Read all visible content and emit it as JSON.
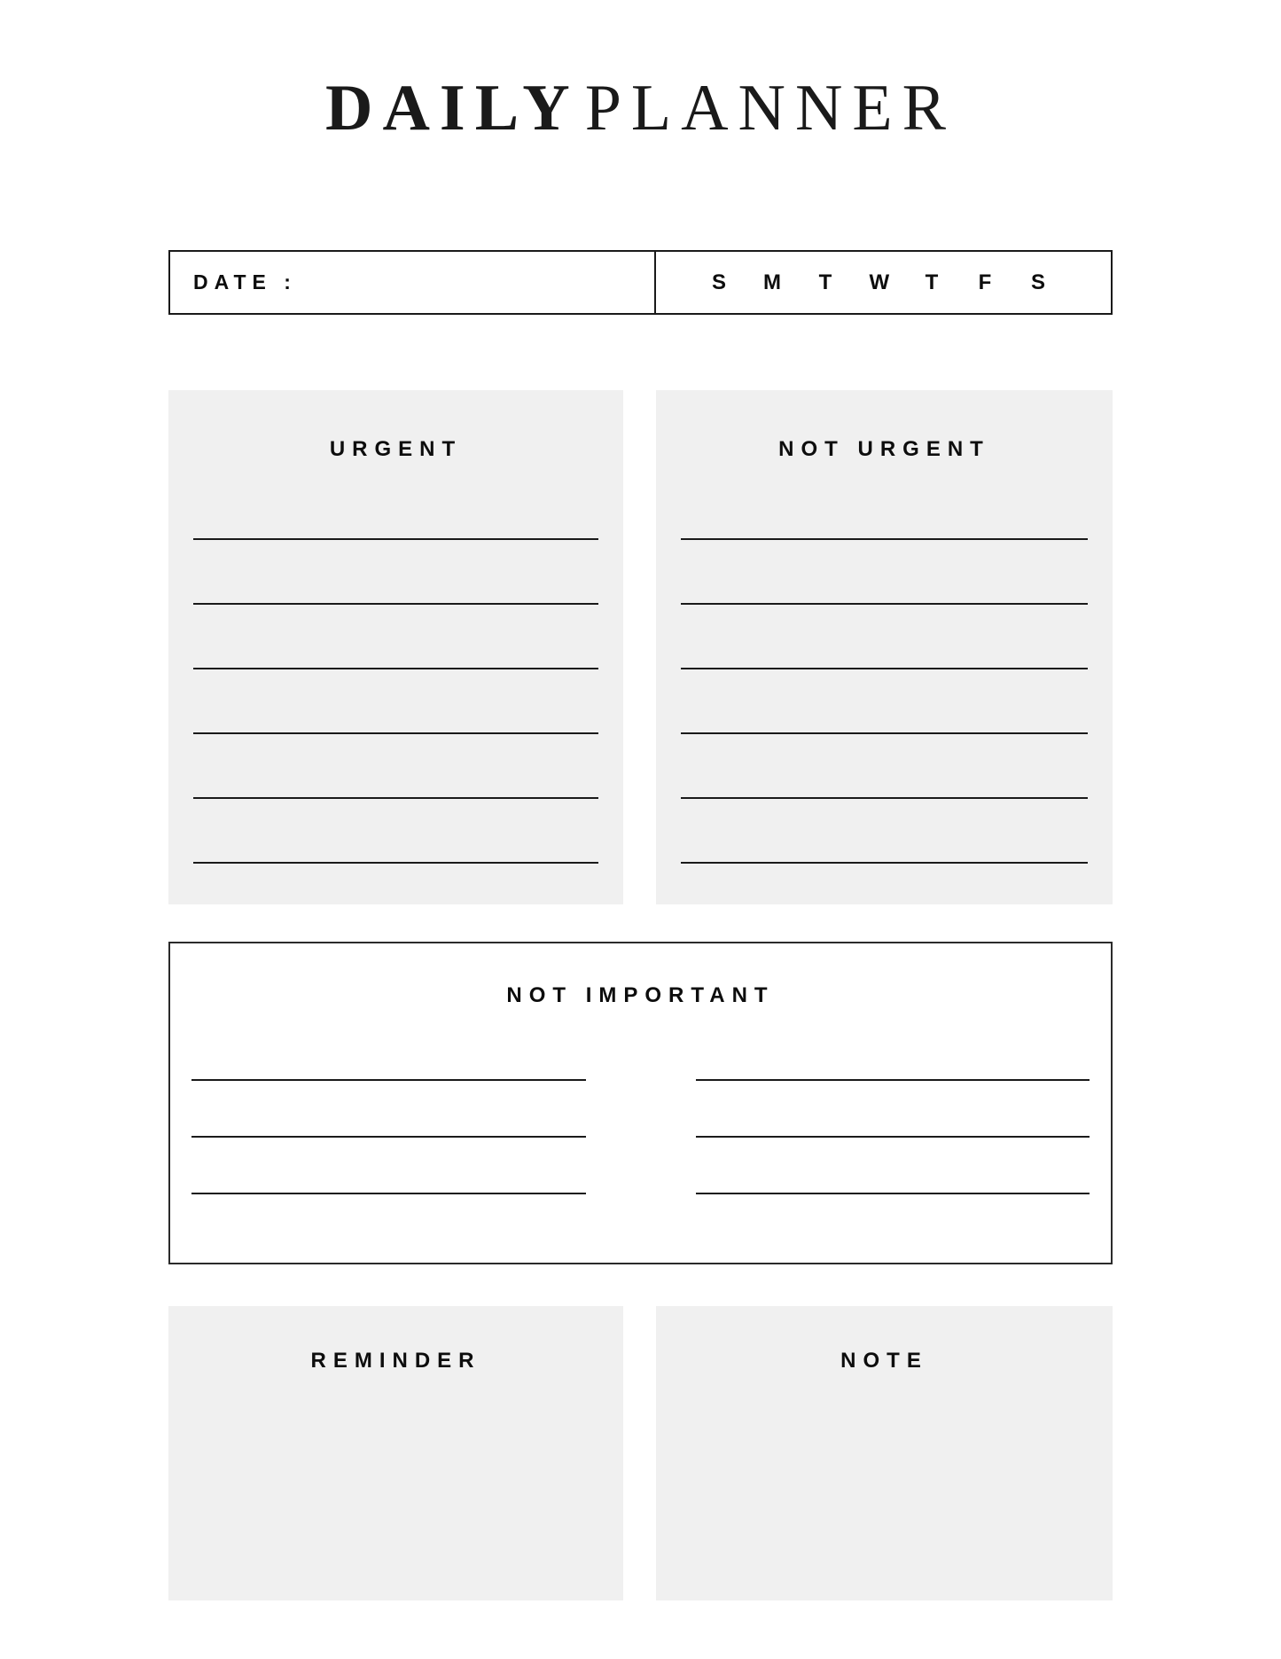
{
  "page": {
    "title_bold": "DAILY",
    "title_light": "PLANNER",
    "background_color": "#ffffff",
    "panel_gray": "#f0f0f0",
    "ink_color": "#1a1a1a"
  },
  "date_row": {
    "date_label": "DATE :",
    "day_letters": [
      "S",
      "M",
      "T",
      "W",
      "T",
      "F",
      "S"
    ]
  },
  "sections": {
    "urgent": {
      "heading": "URGENT",
      "line_count": 6,
      "style": "gray"
    },
    "not_urgent": {
      "heading": "NOT URGENT",
      "line_count": 6,
      "style": "gray"
    },
    "not_important": {
      "heading": "NOT IMPORTANT",
      "style": "outline",
      "left_line_count": 3,
      "right_line_count": 3
    },
    "reminder": {
      "heading": "REMINDER",
      "style": "gray",
      "line_count": 0
    },
    "note": {
      "heading": "NOTE",
      "style": "gray",
      "line_count": 0
    }
  }
}
